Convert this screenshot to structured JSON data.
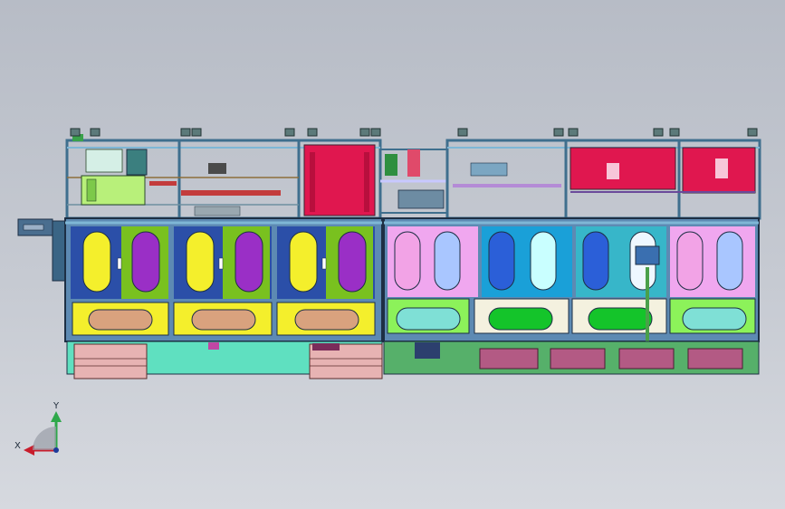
{
  "triad": {
    "x_label": "X",
    "y_label": "Y"
  },
  "colors": {
    "background_top": "#b7bcc6",
    "frame": "#3f6f8e",
    "frame_light": "#7fb7d6",
    "upper_red": "#e0174f",
    "left_base": "#5fe0c0",
    "left_door": "#f4ef2c",
    "left_tank_yellow": "#f4ef2c",
    "left_tank_purple": "#9a2fc6",
    "left_panel_green": "#79c11f",
    "left_module_blue": "#2b4fa8",
    "pad_tan": "#d9a27e",
    "right_base": "#56b06a",
    "right_door": "#8cf25a",
    "right_tank_pink": "#f2a3e6",
    "right_tank_blue": "#2b5fd8",
    "right_tank_lightblue": "#a9c6ff",
    "right_tank_cyan": "#c9ffff",
    "pad_cyan": "#7fe0d6",
    "pad_green": "#14c42a",
    "motor_pink": "#e7b3b3",
    "drawer_mauve": "#b35a84"
  },
  "left_stations": [
    {
      "tanks": [
        "yellow",
        "purple"
      ]
    },
    {
      "tanks": [
        "yellow",
        "purple"
      ]
    },
    {
      "tanks": [
        "yellow",
        "purple"
      ]
    }
  ],
  "right_stations": [
    {
      "tanks": [
        "pink",
        "lightblue"
      ],
      "pad": "cyan",
      "bg": "#f0a7ef"
    },
    {
      "tanks": [
        "blue",
        "cyan"
      ],
      "pad": "green",
      "bg": "#1aa0d8"
    },
    {
      "tanks": [
        "blue",
        "white"
      ],
      "pad": "green",
      "bg": "#37b6c9"
    },
    {
      "tanks": [
        "pink",
        "lightblue"
      ],
      "pad": "cyan",
      "bg": "#f0a7ef"
    }
  ]
}
